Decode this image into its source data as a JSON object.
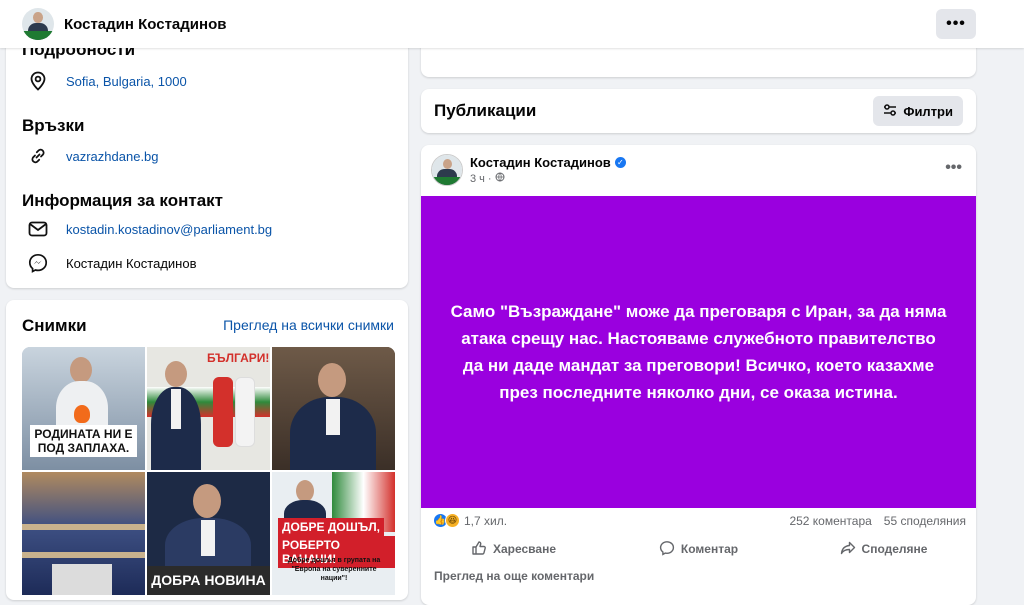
{
  "topbar": {
    "title": "Костадин Костадинов",
    "more_icon": "more-horizontal-icon"
  },
  "details": {
    "heading": "Подробности",
    "location": "Sofia, Bulgaria, 1000",
    "links_heading": "Връзки",
    "website": "vazrazhdane.bg",
    "contact_heading": "Информация за контакт",
    "email": "kostadin.kostadinov@parliament.bg",
    "messenger": "Костадин Костадинов"
  },
  "photos": {
    "heading": "Снимки",
    "see_all": "Преглед на всички снимки",
    "captions": {
      "p1": "РОДИНАТА НИ Е ПОД ЗАПЛАХА.",
      "p2": "БЪЛГАРИ!",
      "p5": "ДОБРА НОВИНА",
      "p6a": "ДОБРЕ ДОШЪЛ,",
      "p6b": "РОБЕРТО ВАНАЧИ!",
      "p6c": "Добре дошъл в групата на \"Европа на суверенните нации\"!"
    }
  },
  "publications": {
    "heading": "Публикации",
    "filter_label": "Филтри"
  },
  "post": {
    "author": "Костадин Костадинов",
    "time": "3 ч",
    "text": "Само \"Възраждане\" може да преговаря с Иран, за да няма атака срещу нас. Настояваме служебното правителство да ни даде мандат за преговори! Всичко, което казахме през последните няколко дни, се оказа истина.",
    "banner_color": "#9a00df",
    "reactions_count": "1,7 хил.",
    "comments_count": "252 коментара",
    "shares_count": "55 споделяния",
    "like_label": "Харесване",
    "comment_label": "Коментар",
    "share_label": "Споделяне",
    "more_comments": "Преглед на още коментари"
  },
  "colors": {
    "link": "#0a54a8",
    "accent": "#1877f2",
    "background": "#f0f2f5"
  }
}
